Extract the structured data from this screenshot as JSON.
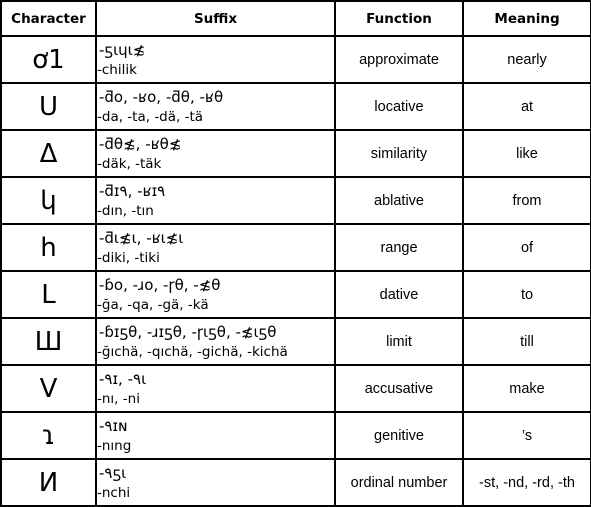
{
  "table": {
    "headers": {
      "character": "Character",
      "suffix": "Suffix",
      "function": "Function",
      "meaning": "Meaning"
    },
    "rows": [
      {
        "character": "ơ1",
        "script": "-ƽɩɥɩ≴",
        "latin": "-chilik",
        "function": "approximate",
        "meaning": "nearly"
      },
      {
        "character": "U",
        "script": "-ƌo, -ʁo, -ƌθ, -ʁθ",
        "latin": "-da, -ta, -dä, -tä",
        "function": "locative",
        "meaning": "at"
      },
      {
        "character": "Δ",
        "script": "-ƌθ≴, -ʁθ≴",
        "latin": "-däk, -täk",
        "function": "similarity",
        "meaning": "like"
      },
      {
        "character": " կ",
        "script": "-ƌɪ٩, -ʁɪ٩",
        "latin": "-dın, -tın",
        "function": "ablative",
        "meaning": "from"
      },
      {
        "character": "h",
        "script": "-ƌɩ≴ɩ, -ʁɩ≴ɩ",
        "latin": "-diki, -tiki",
        "function": "range",
        "meaning": "of"
      },
      {
        "character": "L",
        "script": "-ɓo, -ɹo, -ɼθ, -≴θ",
        "latin": "-ğa, -qa, -gä, -kä",
        "function": "dative",
        "meaning": "to"
      },
      {
        "character": "Ш",
        "script": "-ɓɪƽθ, -ɹɪƽθ, -ɼɩƽθ, -≴ɩƽθ",
        "latin": "-ğıchä, -qıchä, -gichä, -kichä",
        "function": "limit",
        "meaning": "till"
      },
      {
        "character": "V",
        "script": "-٩ɪ, -٩ɩ",
        "latin": "-nı, -ni",
        "function": "accusative",
        "meaning": "make"
      },
      {
        "character": "ɿ",
        "script": "-٩ɪɴ",
        "latin": "-nıng",
        "function": "genitive",
        "meaning": "’s"
      },
      {
        "character": "И",
        "script": "-٩ƽɩ",
        "latin": "-nchi",
        "function": "ordinal number",
        "meaning": "-st, -nd, -rd, -th"
      }
    ]
  }
}
